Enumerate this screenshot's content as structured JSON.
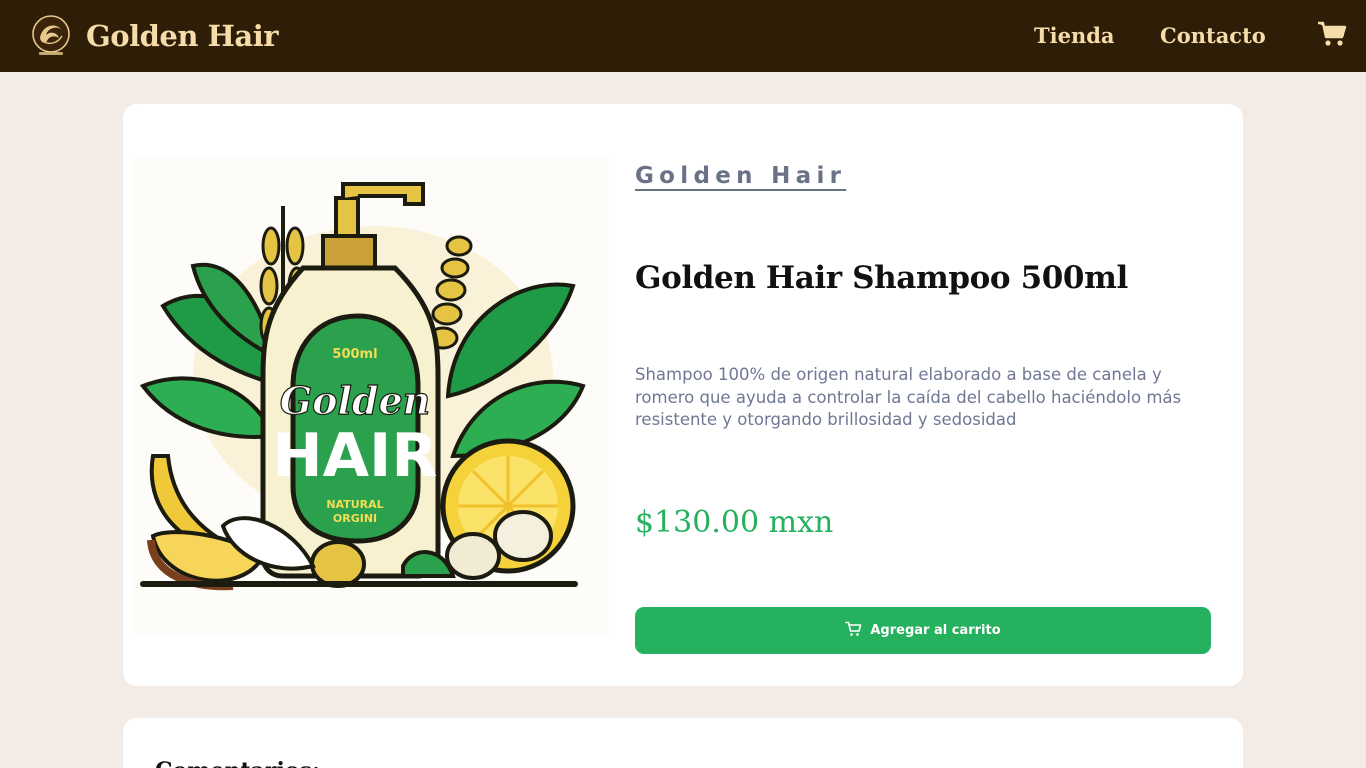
{
  "header": {
    "brand": "Golden Hair",
    "logo_icon": "golden-hair-logo-icon",
    "nav": [
      {
        "label": "Tienda"
      },
      {
        "label": "Contacto"
      }
    ],
    "cart_icon": "shopping-cart-icon"
  },
  "product": {
    "brand_link": "Golden Hair",
    "title": "Golden Hair Shampoo 500ml",
    "description": "Shampoo 100% de origen natural elaborado a base de canela y romero que ayuda a controlar la caída del cabello haciéndolo más resistente y otorgando brillosidad y sedosidad",
    "price": "$130.00 mxn",
    "add_to_cart": "Agregar al carrito",
    "image": {
      "label_top": "500ml",
      "label_line1": "Golden",
      "label_line2": "HAIR",
      "label_line3": "NATURAL",
      "label_line4": "ORGINI"
    }
  },
  "comments": {
    "title": "Comentarios:"
  },
  "colors": {
    "navbar_bg": "#2e1d07",
    "nav_text": "#f5dca8",
    "page_bg": "#f3ebe5",
    "accent_green": "#25b15e",
    "muted_text": "#707795"
  }
}
